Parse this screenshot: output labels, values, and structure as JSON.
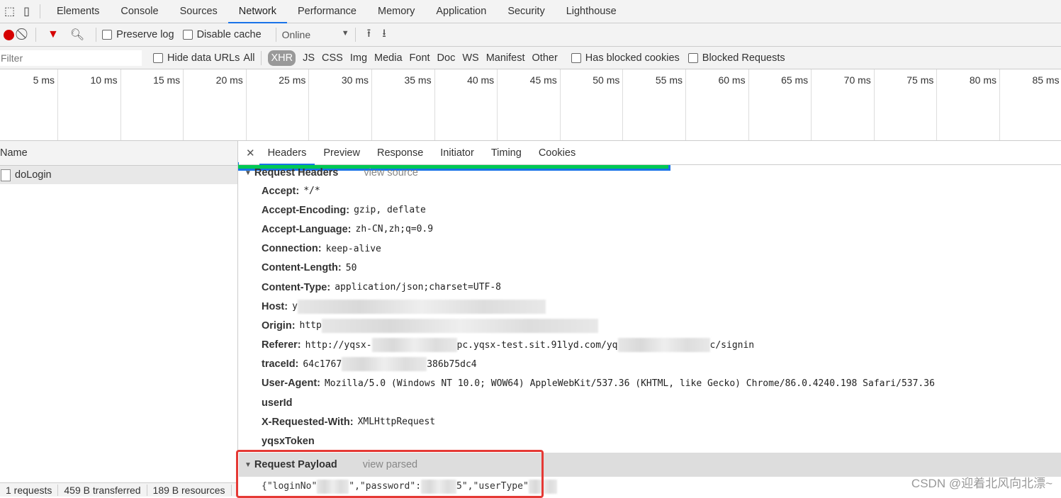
{
  "tabs": [
    "Elements",
    "Console",
    "Sources",
    "Network",
    "Performance",
    "Memory",
    "Application",
    "Security",
    "Lighthouse"
  ],
  "active_tab": "Network",
  "toolbar": {
    "preserve_log": "Preserve log",
    "disable_cache": "Disable cache",
    "throttle": "Online"
  },
  "filter": {
    "placeholder": "Filter",
    "hide_data_urls": "Hide data URLs",
    "types": [
      "All",
      "XHR",
      "JS",
      "CSS",
      "Img",
      "Media",
      "Font",
      "Doc",
      "WS",
      "Manifest",
      "Other"
    ],
    "selected": "XHR",
    "has_blocked_cookies": "Has blocked cookies",
    "blocked_requests": "Blocked Requests"
  },
  "timeline": {
    "ticks": [
      "5 ms",
      "10 ms",
      "15 ms",
      "20 ms",
      "25 ms",
      "30 ms",
      "35 ms",
      "40 ms",
      "45 ms",
      "50 ms",
      "55 ms",
      "60 ms",
      "65 ms",
      "70 ms",
      "75 ms",
      "80 ms",
      "85 ms"
    ]
  },
  "requests": {
    "header": "Name",
    "items": [
      "doLogin"
    ]
  },
  "status": [
    "1 requests",
    "459 B transferred",
    "189 B resources"
  ],
  "details": {
    "tabs": [
      "Headers",
      "Preview",
      "Response",
      "Initiator",
      "Timing",
      "Cookies"
    ],
    "active": "Headers",
    "request_headers_title": "Request Headers",
    "view_source": "view source",
    "headers": [
      {
        "k": "Accept:",
        "v": "*/*"
      },
      {
        "k": "Accept-Encoding:",
        "v": "gzip, deflate"
      },
      {
        "k": "Accept-Language:",
        "v": "zh-CN,zh;q=0.9"
      },
      {
        "k": "Connection:",
        "v": "keep-alive"
      },
      {
        "k": "Content-Length:",
        "v": "50"
      },
      {
        "k": "Content-Type:",
        "v": "application/json;charset=UTF-8"
      },
      {
        "k": "Host:",
        "v": "y"
      },
      {
        "k": "Origin:",
        "v": "http"
      },
      {
        "k": "Referer:",
        "v": "http://yqsx-",
        "v2": "pc.yqsx-test.sit.91lyd.com/yq",
        "v3": "c/signin"
      },
      {
        "k": "traceId:",
        "v": "64c1767",
        "v2": "386b75dc4"
      },
      {
        "k": "User-Agent:",
        "v": "Mozilla/5.0 (Windows NT 10.0; WOW64) AppleWebKit/537.36 (KHTML, like Gecko) Chrome/86.0.4240.198 Safari/537.36"
      },
      {
        "k": "userId",
        "v": ""
      },
      {
        "k": "X-Requested-With:",
        "v": "XMLHttpRequest"
      },
      {
        "k": "yqsxToken",
        "v": ""
      }
    ],
    "payload_title": "Request Payload",
    "view_parsed": "view parsed",
    "payload": {
      "p1": "{\"loginNo\"",
      "p2": "\",\"password\":",
      "p3": "5\",\"userType\""
    }
  },
  "watermark": "CSDN @迎着北风向北漂~",
  "colors": {
    "accent": "#1a73e8",
    "record": "#d50000",
    "highlight": "#e53935"
  }
}
